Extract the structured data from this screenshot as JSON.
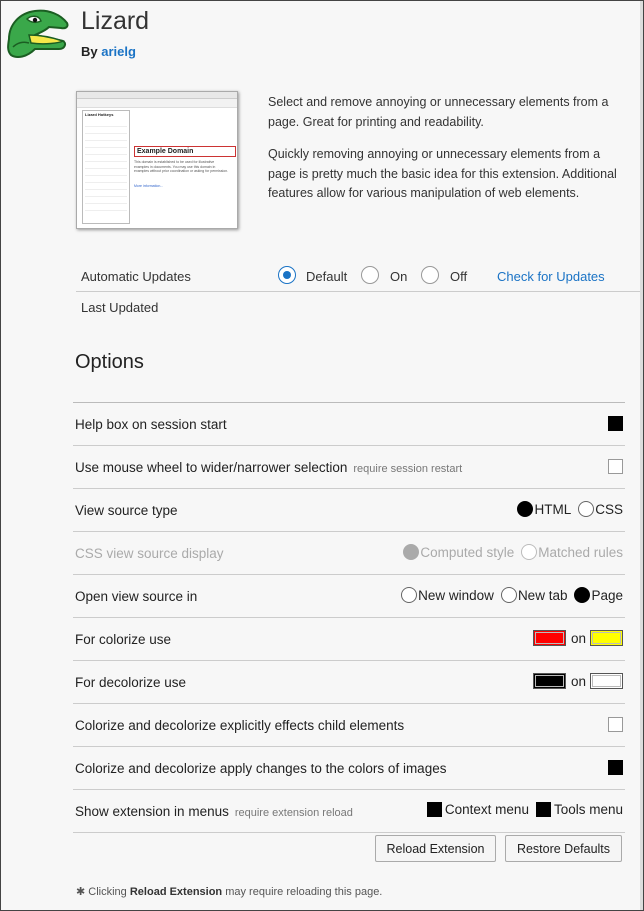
{
  "header": {
    "title": "Lizard",
    "by_label": "By",
    "author": "arielg"
  },
  "thumbnail": {
    "popup_title": "Lizard Hotkeys",
    "domain_title": "Example Domain",
    "domain_text": "This domain is established to be used for illustrative examples in documents. You may use this domain in examples without prior coordination or asking for permission.",
    "more_info": "More information..."
  },
  "description": {
    "p1": "Select and remove annoying or unnecessary elements from a page. Great for printing and readability.",
    "p2": "Quickly removing annoying or unnecessary elements from a page is pretty much the basic idea for this extension. Additional features allow for various manipulation of web elements."
  },
  "updates": {
    "label": "Automatic Updates",
    "options": [
      "Default",
      "On",
      "Off"
    ],
    "selected": "Default",
    "check_link": "Check for Updates",
    "last_updated_label": "Last Updated"
  },
  "options": {
    "title": "Options",
    "help_box": "Help box on session start",
    "mouse_wheel": "Use mouse wheel to wider/narrower selection",
    "mouse_wheel_note": "require session restart",
    "view_source_type": "View source type",
    "vst_html": "HTML",
    "vst_css": "CSS",
    "css_display": "CSS view source display",
    "css_computed": "Computed style",
    "css_matched": "Matched rules",
    "open_in": "Open view source in",
    "open_new_window": "New window",
    "open_new_tab": "New tab",
    "open_page": "Page",
    "colorize": "For colorize use",
    "decolorize": "For decolorize use",
    "on_word": "on",
    "child_elements": "Colorize and decolorize explicitly effects child elements",
    "images": "Colorize and decolorize apply changes to the colors of images",
    "show_in_menus": "Show extension in menus",
    "show_in_menus_note": "require extension reload",
    "context_menu": "Context menu",
    "tools_menu": "Tools menu"
  },
  "colors": {
    "colorize_fg": "#ff0000",
    "colorize_bg": "#ffff00",
    "decolorize_fg": "#000000",
    "decolorize_bg": "#ffffff",
    "link": "#1a73c5"
  },
  "buttons": {
    "reload": "Reload Extension",
    "restore": "Restore Defaults"
  },
  "footnote": {
    "star": "✱ Clicking",
    "bold": "Reload Extension",
    "rest": "may require reloading this page."
  }
}
